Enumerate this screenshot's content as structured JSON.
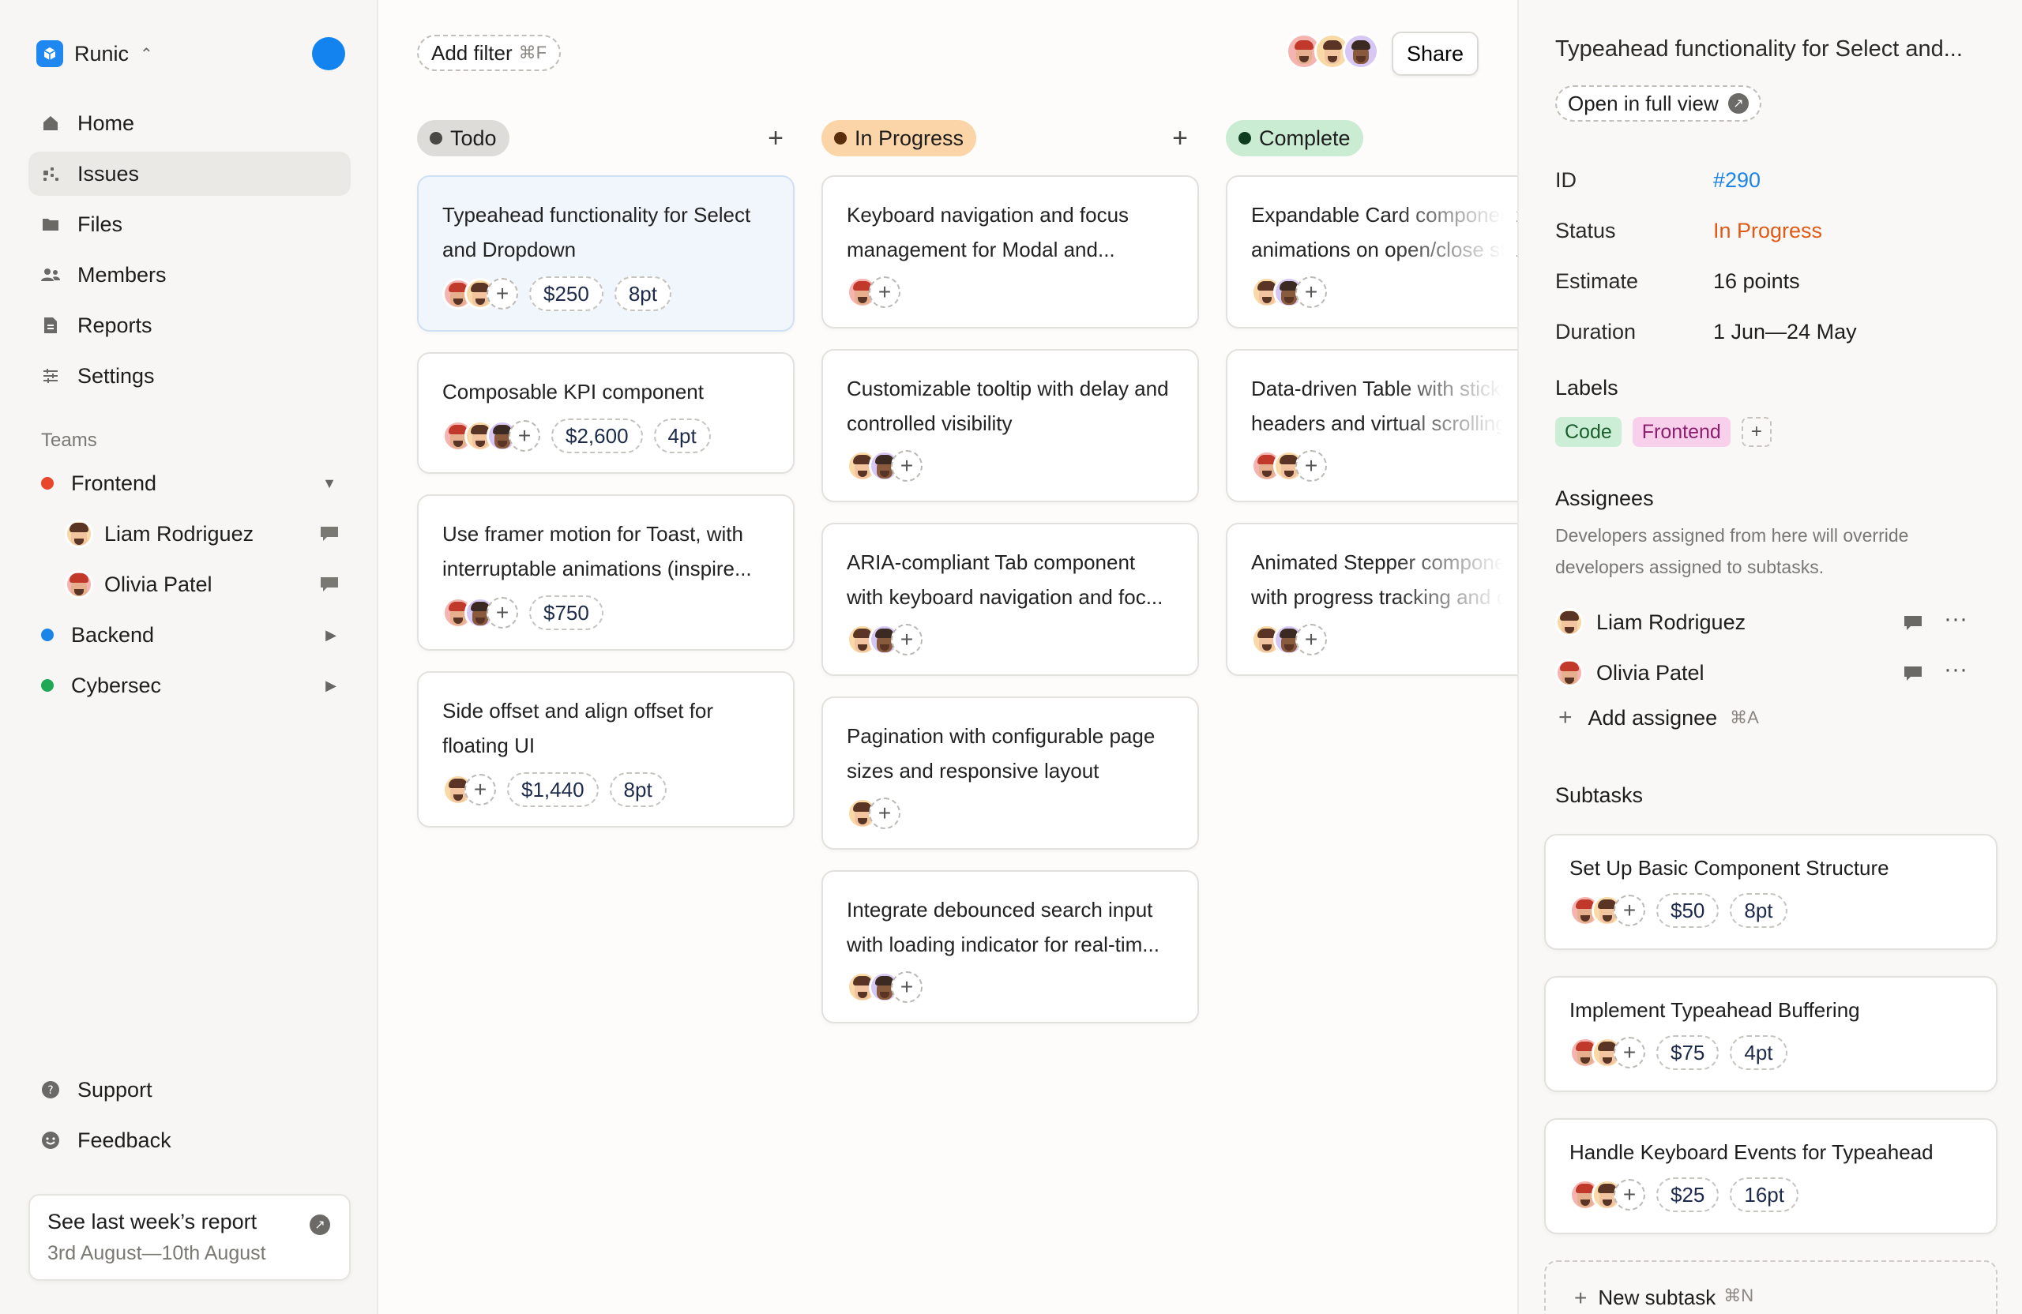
{
  "sidebar": {
    "workspace": "Runic",
    "nav": [
      {
        "label": "Home",
        "icon": "home-icon"
      },
      {
        "label": "Issues",
        "icon": "issues-icon",
        "active": true
      },
      {
        "label": "Files",
        "icon": "folder-icon"
      },
      {
        "label": "Members",
        "icon": "members-icon"
      },
      {
        "label": "Reports",
        "icon": "document-icon"
      },
      {
        "label": "Settings",
        "icon": "sliders-icon"
      }
    ],
    "teams_label": "Teams",
    "teams": [
      {
        "label": "Frontend",
        "color": "#e8472c",
        "members": [
          "Liam Rodriguez",
          "Olivia Patel"
        ]
      },
      {
        "label": "Backend",
        "color": "#1a84e8"
      },
      {
        "label": "Cybersec",
        "color": "#1fa855"
      }
    ],
    "bottom": [
      {
        "label": "Support",
        "icon": "help-icon"
      },
      {
        "label": "Feedback",
        "icon": "smile-icon"
      }
    ],
    "report": {
      "title": "See last week’s report",
      "subtitle": "3rd August—10th August"
    }
  },
  "board": {
    "filter": {
      "label": "Add filter",
      "shortcut": "⌘F"
    },
    "share": "Share",
    "columns": [
      {
        "label": "Todo",
        "pill_bg": "#dedcd8",
        "dot": "#4a4845",
        "cards": [
          {
            "title": "Typeahead functionality for Select and Dropdown",
            "price": "$250",
            "points": "8pt"
          },
          {
            "title": "Composable KPI component",
            "price": "$2,600",
            "points": "4pt"
          },
          {
            "title": "Use framer motion for Toast, with interruptable animations (inspire...",
            "price": "$750"
          },
          {
            "title": "Side offset and align offset for floating UI",
            "price": "$1,440",
            "points": "8pt"
          }
        ]
      },
      {
        "label": "In Progress",
        "pill_bg": "#fbd5a8",
        "dot": "#5a2e0a",
        "cards": [
          {
            "title": "Keyboard navigation and focus management for Modal and..."
          },
          {
            "title": "Customizable tooltip with delay and controlled visibility"
          },
          {
            "title": "ARIA-compliant Tab component with keyboard navigation and foc..."
          },
          {
            "title": "Pagination with configurable page sizes and responsive layout"
          },
          {
            "title": "Integrate debounced search input with loading indicator for real-tim..."
          }
        ]
      },
      {
        "label": "Complete",
        "pill_bg": "#c9ecd3",
        "dot": "#0e3d1e",
        "cards": [
          {
            "line1": "Expandable Card component",
            "line2": "animations on open/close state"
          },
          {
            "line1": "Data-driven Table with sticky",
            "line2": "headers and virtual scrolling"
          },
          {
            "line1": "Animated Stepper component",
            "line2": "with progress tracking and c"
          }
        ]
      }
    ]
  },
  "detail": {
    "title": "Typeahead functionality for Select and...",
    "open_full": "Open in full view",
    "props": [
      {
        "key": "ID",
        "value": "#290"
      },
      {
        "key": "Status",
        "value": "In Progress"
      },
      {
        "key": "Estimate",
        "value": "16 points"
      },
      {
        "key": "Duration",
        "value": "1 Jun—24 May"
      }
    ],
    "labels_heading": "Labels",
    "labels": [
      {
        "text": "Code",
        "bg": "#cdeed6",
        "fg": "#1a5e2e"
      },
      {
        "text": "Frontend",
        "bg": "#f9d0ec",
        "fg": "#8a1f6c"
      }
    ],
    "assignees_heading": "Assignees",
    "assignees_sub": "Developers assigned from here will override developers assigned to subtasks.",
    "assignees": [
      "Liam Rodriguez",
      "Olivia Patel"
    ],
    "add_assignee": "Add assignee",
    "add_assignee_shortcut": "⌘A",
    "subtasks_heading": "Subtasks",
    "subtasks": [
      {
        "title": "Set Up Basic Component Structure",
        "price": "$50",
        "points": "8pt"
      },
      {
        "title": "Implement Typeahead Buffering",
        "price": "$75",
        "points": "4pt"
      },
      {
        "title": "Handle Keyboard Events for Typeahead",
        "price": "$25",
        "points": "16pt"
      }
    ],
    "new_subtask": "New subtask",
    "new_subtask_shortcut": "⌘N"
  }
}
